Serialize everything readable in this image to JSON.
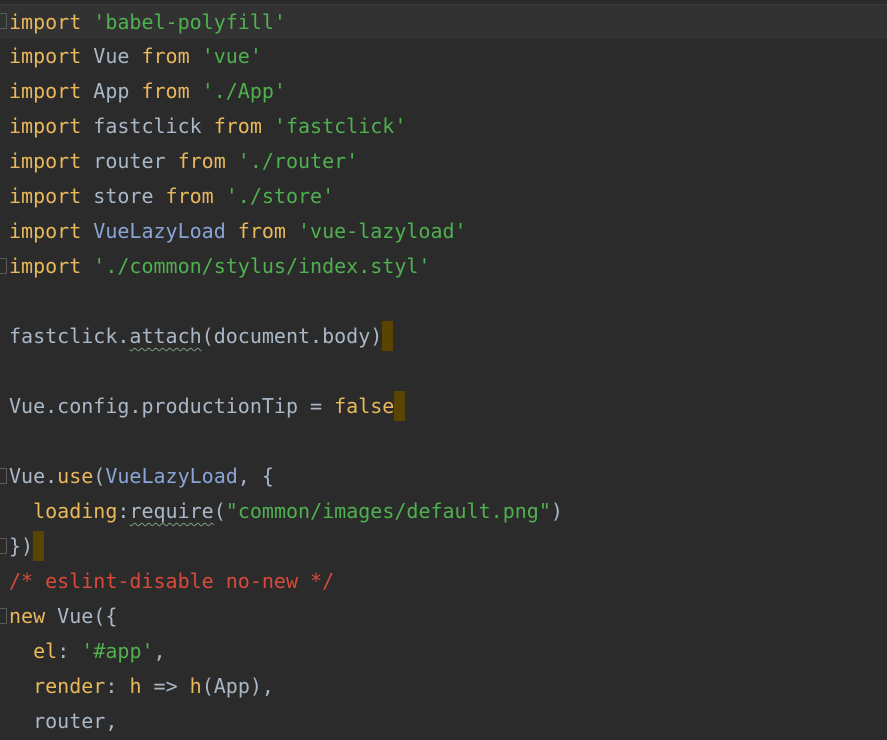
{
  "editor": {
    "lines": [
      {
        "tokens": [
          [
            "imp",
            "import"
          ],
          [
            "ident",
            " "
          ],
          [
            "strg",
            "'babel-polyfill'"
          ]
        ]
      },
      {
        "tokens": [
          [
            "imp",
            "import"
          ],
          [
            "ident",
            " Vue "
          ],
          [
            "imp",
            "from"
          ],
          [
            "ident",
            " "
          ],
          [
            "strg",
            "'vue'"
          ]
        ]
      },
      {
        "tokens": [
          [
            "imp",
            "import"
          ],
          [
            "ident",
            " App "
          ],
          [
            "imp",
            "from"
          ],
          [
            "ident",
            " "
          ],
          [
            "strg",
            "'./App'"
          ]
        ]
      },
      {
        "tokens": [
          [
            "imp",
            "import"
          ],
          [
            "ident",
            " fastclick "
          ],
          [
            "imp",
            "from"
          ],
          [
            "ident",
            " "
          ],
          [
            "strg",
            "'fastclick'"
          ]
        ]
      },
      {
        "tokens": [
          [
            "imp",
            "import"
          ],
          [
            "ident",
            " router "
          ],
          [
            "imp",
            "from"
          ],
          [
            "ident",
            " "
          ],
          [
            "strg",
            "'./router'"
          ]
        ]
      },
      {
        "tokens": [
          [
            "imp",
            "import"
          ],
          [
            "ident",
            " store "
          ],
          [
            "imp",
            "from"
          ],
          [
            "ident",
            " "
          ],
          [
            "strg",
            "'./store'"
          ]
        ]
      },
      {
        "tokens": [
          [
            "imp",
            "import"
          ],
          [
            "ident",
            " "
          ],
          [
            "blueid",
            "VueLazyLoad"
          ],
          [
            "ident",
            " "
          ],
          [
            "imp",
            "from"
          ],
          [
            "ident",
            " "
          ],
          [
            "strg",
            "'vue-lazyload'"
          ]
        ]
      },
      {
        "tokens": [
          [
            "imp",
            "import"
          ],
          [
            "ident",
            " "
          ],
          [
            "strg",
            "'./common/stylus/index.styl'"
          ]
        ]
      },
      {
        "tokens": []
      },
      {
        "tokens": [
          [
            "ident",
            "fastclick."
          ],
          [
            "squig",
            "attach"
          ],
          [
            "ident",
            "(document.body)"
          ],
          [
            "caret",
            ""
          ]
        ]
      },
      {
        "tokens": []
      },
      {
        "tokens": [
          [
            "ident",
            "Vue.config.productionTip = "
          ],
          [
            "imp",
            "false"
          ],
          [
            "caret",
            ""
          ]
        ]
      },
      {
        "tokens": []
      },
      {
        "tokens": [
          [
            "ident",
            "Vue."
          ],
          [
            "imp",
            "use"
          ],
          [
            "ident",
            "("
          ],
          [
            "blueid",
            "VueLazyLoad"
          ],
          [
            "ident",
            ", {"
          ]
        ]
      },
      {
        "tokens": [
          [
            "ident",
            "  "
          ],
          [
            "imp",
            "loading"
          ],
          [
            "ident",
            ":"
          ],
          [
            "squig",
            "require"
          ],
          [
            "ident",
            "("
          ],
          [
            "strg",
            "\"common/images/default.png\""
          ],
          [
            "ident",
            ")"
          ]
        ]
      },
      {
        "tokens": [
          [
            "ident",
            "})"
          ],
          [
            "caret",
            ""
          ]
        ]
      },
      {
        "tokens": [
          [
            "cmt",
            "/* eslint-disable no-new */"
          ]
        ]
      },
      {
        "tokens": [
          [
            "imp",
            "new"
          ],
          [
            "ident",
            " Vue({"
          ]
        ]
      },
      {
        "tokens": [
          [
            "ident",
            "  "
          ],
          [
            "imp",
            "el"
          ],
          [
            "ident",
            ": "
          ],
          [
            "strg",
            "'#app'"
          ],
          [
            "ident",
            ","
          ]
        ]
      },
      {
        "tokens": [
          [
            "ident",
            "  "
          ],
          [
            "imp",
            "render"
          ],
          [
            "ident",
            ": "
          ],
          [
            "imp",
            "h"
          ],
          [
            "ident",
            " => "
          ],
          [
            "imp",
            "h"
          ],
          [
            "ident",
            "(App),"
          ]
        ]
      },
      {
        "tokens": [
          [
            "ident",
            "  router,"
          ]
        ]
      }
    ]
  }
}
